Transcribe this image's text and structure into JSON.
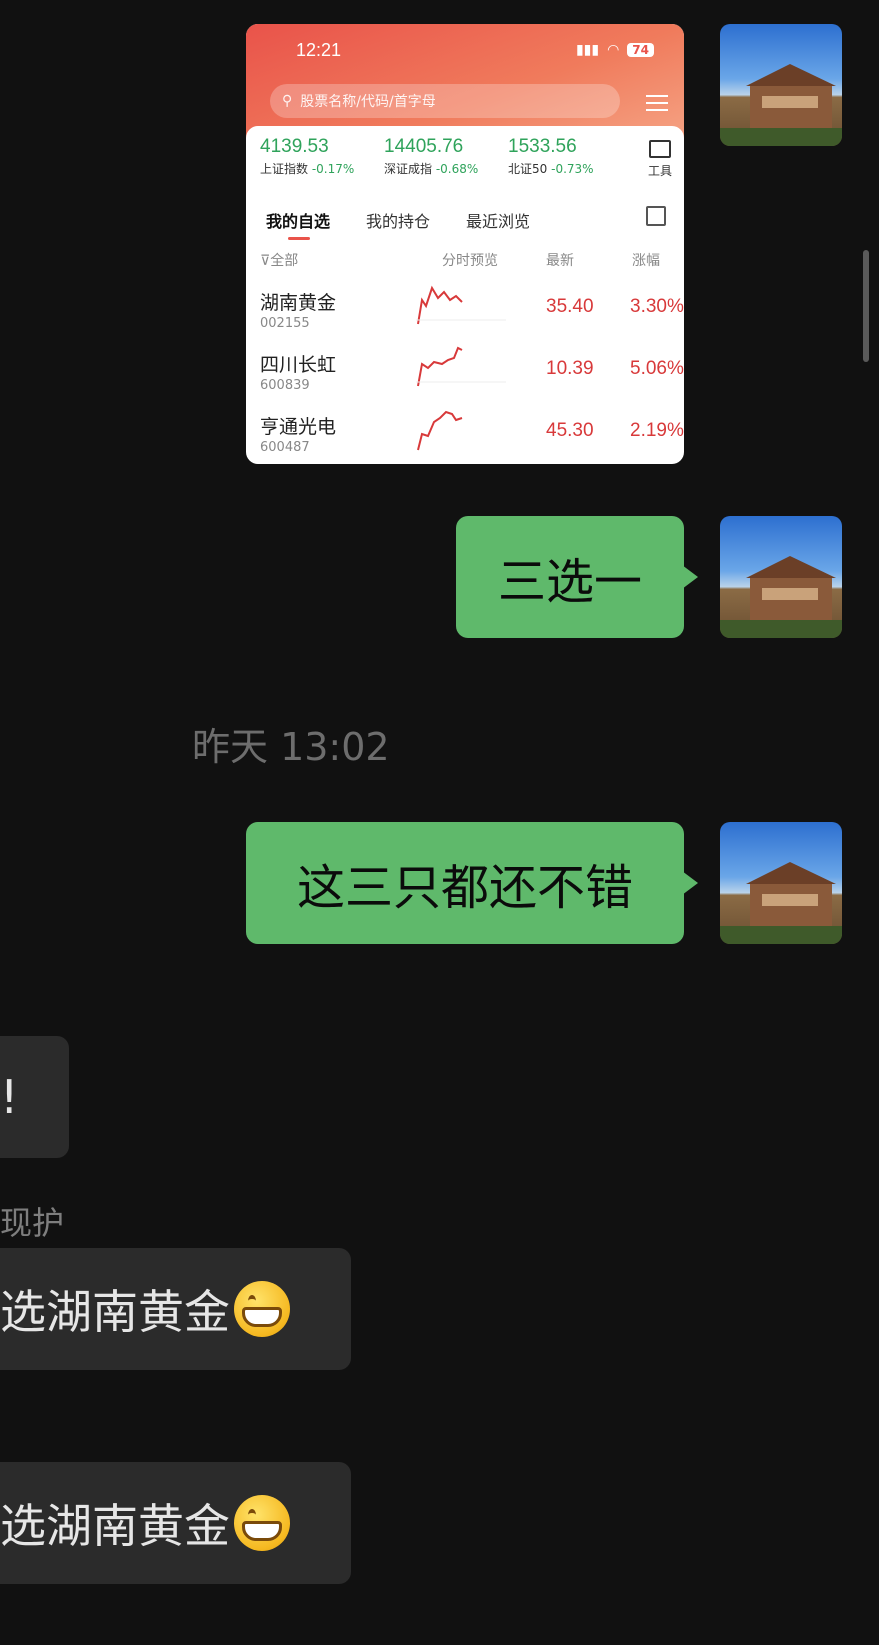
{
  "chat": {
    "timestamp": "昨天 13:02",
    "messages": [
      {
        "type": "image"
      },
      {
        "type": "text",
        "text": "三选一"
      },
      {
        "type": "text",
        "text": "这三只都还不错"
      }
    ],
    "incoming": {
      "partial_text": "!",
      "sender_name": "现护",
      "reply_1": "选湖南黄金",
      "reply_2": "选湖南黄金",
      "emoji": "grinning-face"
    }
  },
  "screenshot": {
    "time": "12:21",
    "battery": "74",
    "search_placeholder": "股票名称/代码/首字母",
    "indices": [
      {
        "value": "4139.53",
        "name": "上证指数",
        "change": "-0.17%"
      },
      {
        "value": "14405.76",
        "name": "深证成指",
        "change": "-0.68%"
      },
      {
        "value": "1533.56",
        "name": "北证50",
        "change": "-0.73%"
      }
    ],
    "tool_label": "工具",
    "tabs": [
      "我的自选",
      "我的持仓",
      "最近浏览"
    ],
    "columns": {
      "filter": "全部",
      "preview": "分时预览",
      "latest": "最新",
      "change": "涨幅"
    },
    "stocks": [
      {
        "name": "湖南黄金",
        "code": "002155",
        "price": "35.40",
        "pct": "3.30%"
      },
      {
        "name": "四川长虹",
        "code": "600839",
        "price": "10.39",
        "pct": "5.06%"
      },
      {
        "name": "亨通光电",
        "code": "600487",
        "price": "45.30",
        "pct": "2.19%"
      }
    ],
    "colors": {
      "up": "#d8393a",
      "down": "#2fa35b",
      "header": "#e9534a"
    }
  },
  "colors": {
    "bubble_green": "#5fb96b",
    "background": "#111111",
    "bubble_dark": "#2b2b2b"
  }
}
